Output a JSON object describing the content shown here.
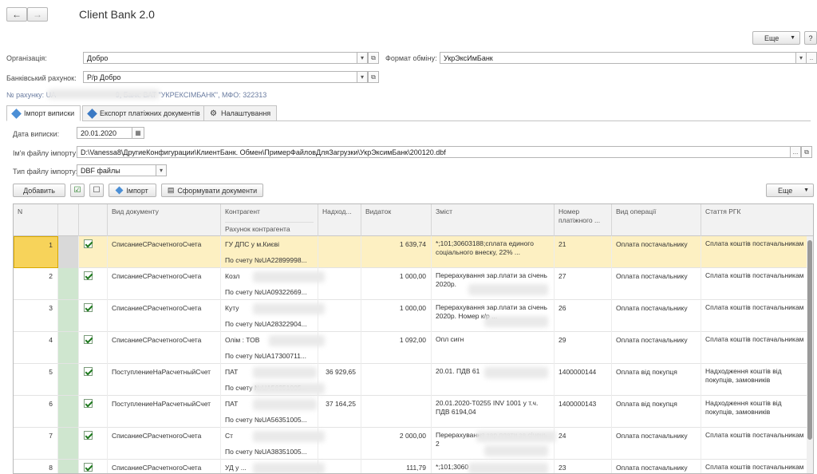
{
  "header": {
    "title": "Client Bank 2.0",
    "more_label": "Еще",
    "help_label": "?"
  },
  "org": {
    "label": "Організація:",
    "value": "Добро"
  },
  "format": {
    "label": "Формат обміну:",
    "value": "УкрЭксИмБанк"
  },
  "account": {
    "label": "Банківський рахунок:",
    "value": "Р/р Добро"
  },
  "account_info": "№ рахунку: UA                              9, Банк: ВАТ \"УКРЕКСІМБАНК\", МФО: 322313",
  "tabs": [
    {
      "label": "Імпорт виписки"
    },
    {
      "label": "Експорт платіжних документів"
    },
    {
      "label": "Налаштування"
    }
  ],
  "form": {
    "date_label": "Дата виписки:",
    "date_value": "20.01.2020",
    "file_label": "Ім'я файлу імпорту:",
    "file_value": "D:\\Vanessa8\\ДругиеКонфигурации\\КлиентБанк. Обмен\\ПримерФайловДляЗагрузки\\УкрЭксимБанк\\200120.dbf",
    "type_label": "Тип файлу імпорту:",
    "type_value": "DBF файлы"
  },
  "toolbar": {
    "add_label": "Добавить",
    "import_label": "Імпорт",
    "create_docs_label": "Сформувати документи",
    "more_label": "Еще"
  },
  "columns": {
    "n": "N",
    "doc_type": "Вид документу",
    "counterparty": "Контрагент",
    "counterparty_account": "Рахунок контрагента",
    "income": "Надход...",
    "expense": "Видаток",
    "content": "Зміст",
    "pay_number": "Номер платіжного ...",
    "operation": "Вид операції",
    "rgk": "Стаття РГК"
  },
  "rows": [
    {
      "n": "1",
      "doc": "СписаниеСРасчетногоСчета",
      "cp": "ГУ ДПС у м.Києві",
      "acc": "По счету №UA22899998...",
      "income": "",
      "expense": "1 639,74",
      "content": "*;101;30603188;сплата единого соціального внеску, 22% ...",
      "pay": "21",
      "op": "Оплата постачальнику",
      "rgk": "Сплата коштів постачальникам"
    },
    {
      "n": "2",
      "doc": "СписаниеСРасчетногоСчета",
      "cp": "Козл",
      "acc": "По счету №UA09322669...",
      "income": "",
      "expense": "1 000,00",
      "content": "Перерахування зар.плати за січень 2020р.",
      "pay": "27",
      "op": "Оплата постачальнику",
      "rgk": "Сплата коштів постачальникам"
    },
    {
      "n": "3",
      "doc": "СписаниеСРасчетногоСчета",
      "cp": "Куту",
      "acc": "По счету №UA28322904...",
      "income": "",
      "expense": "1 000,00",
      "content": "Перерахування зар.плати за січень 2020р. Номер к/р ...",
      "pay": "26",
      "op": "Оплата постачальнику",
      "rgk": "Сплата коштів постачальникам"
    },
    {
      "n": "4",
      "doc": "СписаниеСРасчетногоСчета",
      "cp": "Олім                    : ТОВ",
      "acc": "По счету №UA17300711...",
      "income": "",
      "expense": "1 092,00",
      "content": "Опл                         сигн",
      "pay": "29",
      "op": "Оплата постачальнику",
      "rgk": "Сплата коштів постачальникам"
    },
    {
      "n": "5",
      "doc": "ПоступлениеНаРасчетныйСчет",
      "cp": "ПАТ",
      "acc": "По счету №UA56351005...",
      "income": "36 929,65",
      "expense": "",
      "content": "20.01.        ПДВ 61",
      "pay": "1400000144",
      "op": "Оплата від покупця",
      "rgk": "Надходження коштів від покупців, замовників"
    },
    {
      "n": "6",
      "doc": "ПоступлениеНаРасчетныйСчет",
      "cp": "ПАТ",
      "acc": "По счету №UA56351005...",
      "income": "37 164,25",
      "expense": "",
      "content": "20.01.2020-T0255 INV 1001 у т.ч. ПДВ 6194,04",
      "pay": "1400000143",
      "op": "Оплата від покупця",
      "rgk": "Надходження коштів від покупців, замовників"
    },
    {
      "n": "7",
      "doc": "СписаниеСРасчетногоСчета",
      "cp": "Ст",
      "acc": "По счету №UA38351005...",
      "income": "",
      "expense": "2 000,00",
      "content": "Перерахування зар.плати за січень 2",
      "pay": "24",
      "op": "Оплата постачальнику",
      "rgk": "Сплата коштів постачальникам"
    },
    {
      "n": "8",
      "doc": "СписаниеСРасчетногоСчета",
      "cp": "УД                      у ...",
      "acc": "",
      "income": "",
      "expense": "111,79",
      "content": "*;101;3060",
      "pay": "23",
      "op": "Оплата постачальнику",
      "rgk": "Сплата коштів постачальникам"
    }
  ]
}
